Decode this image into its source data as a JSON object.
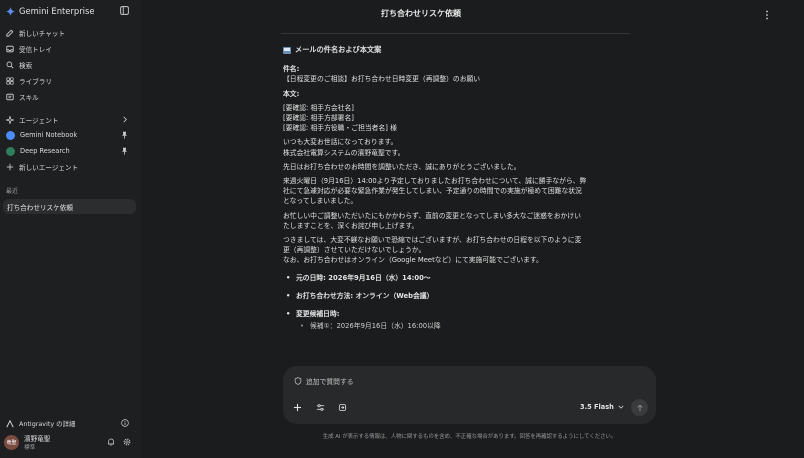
{
  "sidebar": {
    "brand": "Gemini Enterprise",
    "nav": [
      {
        "label": "新しいチャット",
        "icon": "new-chat-icon"
      },
      {
        "label": "受信トレイ",
        "icon": "inbox-icon"
      },
      {
        "label": "検索",
        "icon": "search-icon"
      },
      {
        "label": "ライブラリ",
        "icon": "library-icon"
      },
      {
        "label": "スキル",
        "icon": "skills-icon"
      }
    ],
    "agents_label": "エージェント",
    "agents": [
      {
        "label": "Gemini Notebook",
        "color": "#4a8cff"
      },
      {
        "label": "Deep Research",
        "color": "#2e7d5b"
      }
    ],
    "new_agent_label": "新しいエージェント",
    "recent_label": "最近",
    "recent_items": [
      "打ち合わせリスケ依頼"
    ],
    "antigravity_label": "Antigravity の詳細",
    "user_name": "濱野竜聖",
    "user_plan": "標準",
    "avatar_text": "竜聖"
  },
  "header": {
    "title": "打ち合わせリスケ依頼"
  },
  "message": {
    "section_title": "メールの件名および本文案",
    "subject_label": "件名:",
    "subject": "【日程変更のご相談】お打ち合わせ日時変更（再調整）のお願い",
    "body_label": "本文:",
    "address_lines": [
      "[要確認: 相手方会社名]",
      "[要確認: 相手方部署名]",
      "[要確認: 相手方役職・ご担当者名] 様"
    ],
    "greeting": "いつも大変お世話になっております。",
    "sender": "株式会社電算システムの濱野竜聖です。",
    "p1": "先日はお打ち合わせのお時間を調整いただき、誠にありがとうございました。",
    "p2_lines": [
      "来週火曜日（9月16日）14:00より予定しておりましたお打ち合わせについて、誠に勝手ながら、弊",
      "社にて急遽対応が必要な緊急作業が発生してしまい、予定通りの時間での実施が極めて困難な状況",
      "となってしまいました。"
    ],
    "p3_lines": [
      "お忙しい中ご調整いただいたにもかかわらず、直前の変更となってしまい多大なご迷惑をおかけい",
      "たしますことを、深くお詫び申し上げます。"
    ],
    "p4_lines": [
      "つきましては、大変不躾なお願いで恐縮ではございますが、お打ち合わせの日程を以下のように変",
      "更（再調整）させていただけないでしょうか。",
      "なお、お打ち合わせはオンライン（Google Meetなど）にて実施可能でございます。"
    ],
    "bullets": [
      "元の日時: 2026年9月16日（水）14:00〜",
      "お打ち合わせ方法: オンライン（Web会議）",
      "変更候補日時:"
    ],
    "sub_bullets": [
      "候補①：2026年9月16日（水）16:00以降"
    ]
  },
  "composer": {
    "placeholder": "追加で質問する",
    "model": "3.5 Flash"
  },
  "disclaimer": "生成 AI が表示する情報は、人物に関するものを含め、不正確な場合があります。回答を再確認するようにしてください。"
}
